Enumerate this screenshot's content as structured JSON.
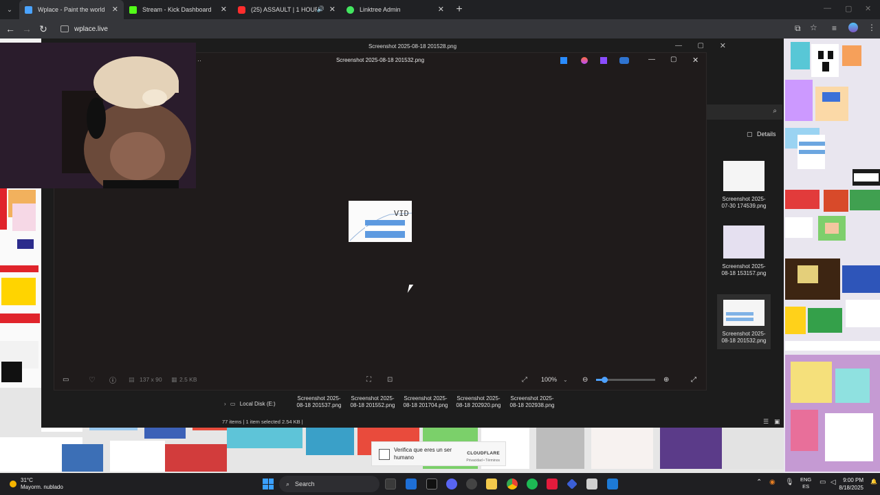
{
  "browser": {
    "tabs": [
      {
        "title": "Wplace - Paint the world",
        "active": true,
        "color": "#4aa3ff"
      },
      {
        "title": "Stream - Kick Dashboard",
        "active": false,
        "color": "#53fc18"
      },
      {
        "title": "(25) ASSAULT | 1 HOUR of",
        "active": false,
        "color": "#ff2d2d"
      },
      {
        "title": "Linktree Admin",
        "active": false,
        "color": "#43e660"
      }
    ],
    "address": "wplace.live"
  },
  "explorer": {
    "title": "Screenshot 2025-08-18 201528.png",
    "details_label": "Details",
    "side_thumbs": [
      {
        "label": "Screenshot 2025-07-30 174539.png"
      },
      {
        "label": "Screenshot 2025-08-18 153157.png"
      },
      {
        "label": "Screenshot 2025-08-18 201532.png"
      }
    ],
    "bottom_thumbs": [
      {
        "label": "Screenshot 2025-08-18 201537.png"
      },
      {
        "label": "Screenshot 2025-08-18 201552.png"
      },
      {
        "label": "Screenshot 2025-08-18 201704.png"
      },
      {
        "label": "Screenshot 2025-08-18 202920.png"
      },
      {
        "label": "Screenshot 2025-08-18 202938.png"
      }
    ],
    "nav_item": "Local Disk (E:)",
    "status": "77 items  |  1 item selected  2.54 KB  |"
  },
  "viewer": {
    "title": "Screenshot 2025-08-18 201532.png",
    "image_text": "VID",
    "dimensions": "137 x 90",
    "file_size": "2.5 KB",
    "zoom": "100%"
  },
  "captcha": {
    "text": "Verifica que eres un ser humano",
    "brand": "CLOUDFLARE",
    "legal": "Privacidad  •  Términos"
  },
  "taskbar": {
    "temperature": "31°C",
    "weather": "Mayorm. nublado",
    "search": "Search",
    "lang1": "ENG",
    "lang2": "ES",
    "time": "9:00 PM",
    "date": "8/18/2025"
  }
}
